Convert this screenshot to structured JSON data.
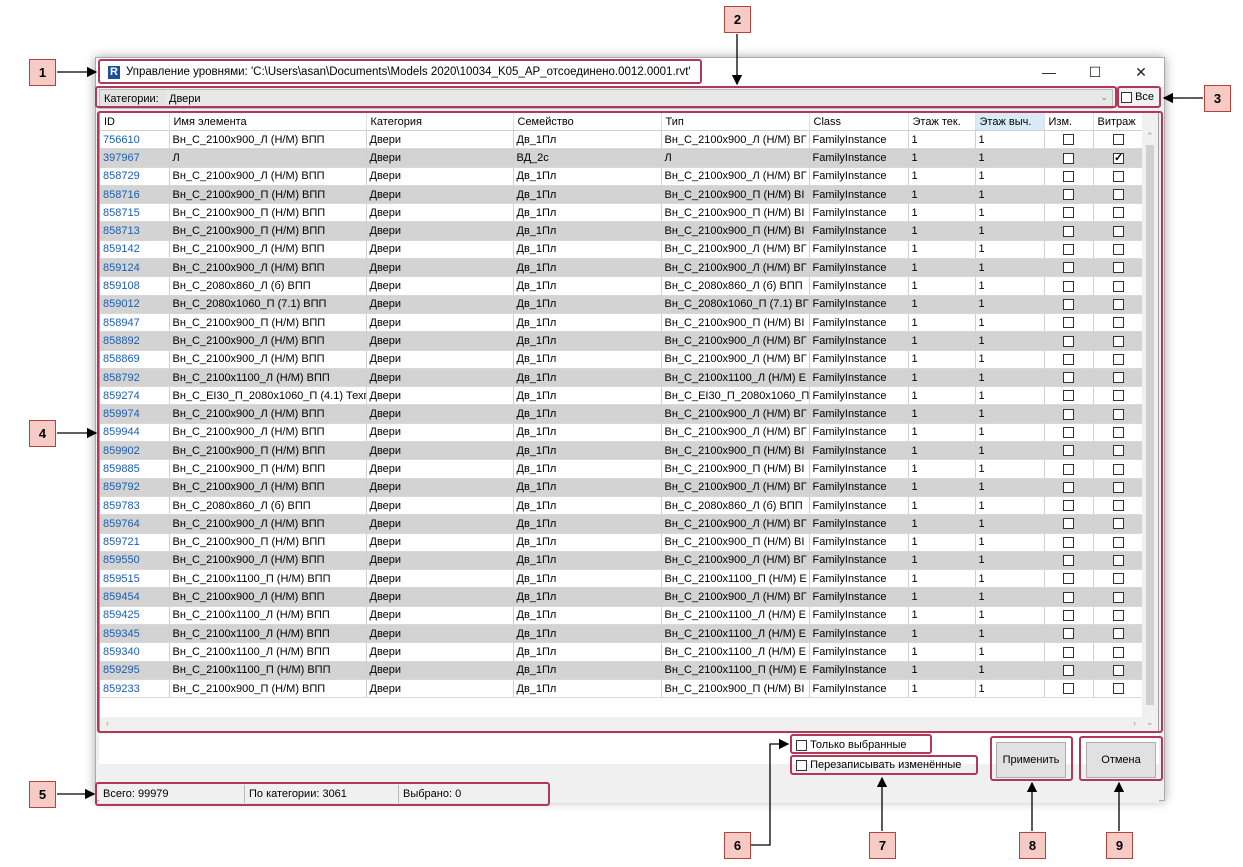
{
  "window": {
    "title": "Управление уровнями: 'C:\\Users\\asan\\Documents\\Models 2020\\10034_K05_AP_отсоединено.0012.0001.rvt'",
    "app_icon_letter": "R",
    "minimize": "—",
    "maximize": "☐",
    "close": "✕"
  },
  "category": {
    "label": "Категории:",
    "value": "Двери",
    "all_label": "Все"
  },
  "table": {
    "columns": [
      "ID",
      "Имя элемента",
      "Категория",
      "Семейство",
      "Тип",
      "Class",
      "Этаж тек.",
      "Этаж выч.",
      "Изм.",
      "Витраж"
    ],
    "rows": [
      {
        "id": "756610",
        "name": "Вн_С_2100х900_Л (Н/М) ВПП",
        "cat": "Двери",
        "family": "Дв_1Пл",
        "type": "Вн_С_2100х900_Л (Н/М) ВГ",
        "cls": "FamilyInstance",
        "cur": "1",
        "calc": "1",
        "mod": false,
        "wall": false
      },
      {
        "id": "397967",
        "name": "Л",
        "cat": "Двери",
        "family": "ВД_2с",
        "type": "Л",
        "cls": "FamilyInstance",
        "cur": "1",
        "calc": "1",
        "mod": false,
        "wall": true
      },
      {
        "id": "858729",
        "name": "Вн_С_2100х900_Л (Н/М) ВПП",
        "cat": "Двери",
        "family": "Дв_1Пл",
        "type": "Вн_С_2100х900_Л (Н/М) ВГ",
        "cls": "FamilyInstance",
        "cur": "1",
        "calc": "1",
        "mod": false,
        "wall": false
      },
      {
        "id": "858716",
        "name": "Вн_С_2100х900_П (Н/М) ВПП",
        "cat": "Двери",
        "family": "Дв_1Пл",
        "type": "Вн_С_2100х900_П (Н/М) ВІ",
        "cls": "FamilyInstance",
        "cur": "1",
        "calc": "1",
        "mod": false,
        "wall": false
      },
      {
        "id": "858715",
        "name": "Вн_С_2100х900_П (Н/М) ВПП",
        "cat": "Двери",
        "family": "Дв_1Пл",
        "type": "Вн_С_2100х900_П (Н/М) ВІ",
        "cls": "FamilyInstance",
        "cur": "1",
        "calc": "1",
        "mod": false,
        "wall": false
      },
      {
        "id": "858713",
        "name": "Вн_С_2100х900_П (Н/М) ВПП",
        "cat": "Двери",
        "family": "Дв_1Пл",
        "type": "Вн_С_2100х900_П (Н/М) ВІ",
        "cls": "FamilyInstance",
        "cur": "1",
        "calc": "1",
        "mod": false,
        "wall": false
      },
      {
        "id": "859142",
        "name": "Вн_С_2100х900_Л (Н/М) ВПП",
        "cat": "Двери",
        "family": "Дв_1Пл",
        "type": "Вн_С_2100х900_Л (Н/М) ВГ",
        "cls": "FamilyInstance",
        "cur": "1",
        "calc": "1",
        "mod": false,
        "wall": false
      },
      {
        "id": "859124",
        "name": "Вн_С_2100х900_Л (Н/М) ВПП",
        "cat": "Двери",
        "family": "Дв_1Пл",
        "type": "Вн_С_2100х900_Л (Н/М) ВГ",
        "cls": "FamilyInstance",
        "cur": "1",
        "calc": "1",
        "mod": false,
        "wall": false
      },
      {
        "id": "859108",
        "name": "Вн_С_2080х860_Л (б) ВПП",
        "cat": "Двери",
        "family": "Дв_1Пл",
        "type": "Вн_С_2080х860_Л (б) ВПП",
        "cls": "FamilyInstance",
        "cur": "1",
        "calc": "1",
        "mod": false,
        "wall": false
      },
      {
        "id": "859012",
        "name": "Вн_С_2080х1060_П (7.1) ВПП",
        "cat": "Двери",
        "family": "Дв_1Пл",
        "type": "Вн_С_2080х1060_П (7.1) ВГ",
        "cls": "FamilyInstance",
        "cur": "1",
        "calc": "1",
        "mod": false,
        "wall": false
      },
      {
        "id": "858947",
        "name": "Вн_С_2100х900_П (Н/М) ВПП",
        "cat": "Двери",
        "family": "Дв_1Пл",
        "type": "Вн_С_2100х900_П (Н/М) ВІ",
        "cls": "FamilyInstance",
        "cur": "1",
        "calc": "1",
        "mod": false,
        "wall": false
      },
      {
        "id": "858892",
        "name": "Вн_С_2100х900_Л (Н/М) ВПП",
        "cat": "Двери",
        "family": "Дв_1Пл",
        "type": "Вн_С_2100х900_Л (Н/М) ВГ",
        "cls": "FamilyInstance",
        "cur": "1",
        "calc": "1",
        "mod": false,
        "wall": false
      },
      {
        "id": "858869",
        "name": "Вн_С_2100х900_Л (Н/М) ВПП",
        "cat": "Двери",
        "family": "Дв_1Пл",
        "type": "Вн_С_2100х900_Л (Н/М) ВГ",
        "cls": "FamilyInstance",
        "cur": "1",
        "calc": "1",
        "mod": false,
        "wall": false
      },
      {
        "id": "858792",
        "name": "Вн_С_2100х1100_Л (Н/М) ВПП",
        "cat": "Двери",
        "family": "Дв_1Пл",
        "type": "Вн_С_2100х1100_Л (Н/М) Е",
        "cls": "FamilyInstance",
        "cur": "1",
        "calc": "1",
        "mod": false,
        "wall": false
      },
      {
        "id": "859274",
        "name": "Вн_С_EI30_П_2080х1060_П (4.1) Техп",
        "cat": "Двери",
        "family": "Дв_1Пл",
        "type": "Вн_С_EI30_П_2080х1060_П",
        "cls": "FamilyInstance",
        "cur": "1",
        "calc": "1",
        "mod": false,
        "wall": false
      },
      {
        "id": "859974",
        "name": "Вн_С_2100х900_Л (Н/М) ВПП",
        "cat": "Двери",
        "family": "Дв_1Пл",
        "type": "Вн_С_2100х900_Л (Н/М) ВГ",
        "cls": "FamilyInstance",
        "cur": "1",
        "calc": "1",
        "mod": false,
        "wall": false
      },
      {
        "id": "859944",
        "name": "Вн_С_2100х900_Л (Н/М) ВПП",
        "cat": "Двери",
        "family": "Дв_1Пл",
        "type": "Вн_С_2100х900_Л (Н/М) ВГ",
        "cls": "FamilyInstance",
        "cur": "1",
        "calc": "1",
        "mod": false,
        "wall": false
      },
      {
        "id": "859902",
        "name": "Вн_С_2100х900_П (Н/М) ВПП",
        "cat": "Двери",
        "family": "Дв_1Пл",
        "type": "Вн_С_2100х900_П (Н/М) ВІ",
        "cls": "FamilyInstance",
        "cur": "1",
        "calc": "1",
        "mod": false,
        "wall": false
      },
      {
        "id": "859885",
        "name": "Вн_С_2100х900_П (Н/М) ВПП",
        "cat": "Двери",
        "family": "Дв_1Пл",
        "type": "Вн_С_2100х900_П (Н/М) ВІ",
        "cls": "FamilyInstance",
        "cur": "1",
        "calc": "1",
        "mod": false,
        "wall": false
      },
      {
        "id": "859792",
        "name": "Вн_С_2100х900_Л (Н/М) ВПП",
        "cat": "Двери",
        "family": "Дв_1Пл",
        "type": "Вн_С_2100х900_Л (Н/М) ВГ",
        "cls": "FamilyInstance",
        "cur": "1",
        "calc": "1",
        "mod": false,
        "wall": false
      },
      {
        "id": "859783",
        "name": "Вн_С_2080х860_Л (б) ВПП",
        "cat": "Двери",
        "family": "Дв_1Пл",
        "type": "Вн_С_2080х860_Л (б) ВПП",
        "cls": "FamilyInstance",
        "cur": "1",
        "calc": "1",
        "mod": false,
        "wall": false
      },
      {
        "id": "859764",
        "name": "Вн_С_2100х900_Л (Н/М) ВПП",
        "cat": "Двери",
        "family": "Дв_1Пл",
        "type": "Вн_С_2100х900_Л (Н/М) ВГ",
        "cls": "FamilyInstance",
        "cur": "1",
        "calc": "1",
        "mod": false,
        "wall": false
      },
      {
        "id": "859721",
        "name": "Вн_С_2100х900_П (Н/М) ВПП",
        "cat": "Двери",
        "family": "Дв_1Пл",
        "type": "Вн_С_2100х900_П (Н/М) ВІ",
        "cls": "FamilyInstance",
        "cur": "1",
        "calc": "1",
        "mod": false,
        "wall": false
      },
      {
        "id": "859550",
        "name": "Вн_С_2100х900_Л (Н/М) ВПП",
        "cat": "Двери",
        "family": "Дв_1Пл",
        "type": "Вн_С_2100х900_Л (Н/М) ВГ",
        "cls": "FamilyInstance",
        "cur": "1",
        "calc": "1",
        "mod": false,
        "wall": false
      },
      {
        "id": "859515",
        "name": "Вн_С_2100х1100_П (Н/М) ВПП",
        "cat": "Двери",
        "family": "Дв_1Пл",
        "type": "Вн_С_2100х1100_П (Н/М) Е",
        "cls": "FamilyInstance",
        "cur": "1",
        "calc": "1",
        "mod": false,
        "wall": false
      },
      {
        "id": "859454",
        "name": "Вн_С_2100х900_Л (Н/М) ВПП",
        "cat": "Двери",
        "family": "Дв_1Пл",
        "type": "Вн_С_2100х900_Л (Н/М) ВГ",
        "cls": "FamilyInstance",
        "cur": "1",
        "calc": "1",
        "mod": false,
        "wall": false
      },
      {
        "id": "859425",
        "name": "Вн_С_2100х1100_Л (Н/М) ВПП",
        "cat": "Двери",
        "family": "Дв_1Пл",
        "type": "Вн_С_2100х1100_Л (Н/М) Е",
        "cls": "FamilyInstance",
        "cur": "1",
        "calc": "1",
        "mod": false,
        "wall": false
      },
      {
        "id": "859345",
        "name": "Вн_С_2100х1100_Л (Н/М) ВПП",
        "cat": "Двери",
        "family": "Дв_1Пл",
        "type": "Вн_С_2100х1100_Л (Н/М) Е",
        "cls": "FamilyInstance",
        "cur": "1",
        "calc": "1",
        "mod": false,
        "wall": false
      },
      {
        "id": "859340",
        "name": "Вн_С_2100х1100_Л (Н/М) ВПП",
        "cat": "Двери",
        "family": "Дв_1Пл",
        "type": "Вн_С_2100х1100_Л (Н/М) Е",
        "cls": "FamilyInstance",
        "cur": "1",
        "calc": "1",
        "mod": false,
        "wall": false
      },
      {
        "id": "859295",
        "name": "Вн_С_2100х1100_П (Н/М) ВПП",
        "cat": "Двери",
        "family": "Дв_1Пл",
        "type": "Вн_С_2100х1100_П (Н/М) Е",
        "cls": "FamilyInstance",
        "cur": "1",
        "calc": "1",
        "mod": false,
        "wall": false
      },
      {
        "id": "859233",
        "name": "Вн_С_2100х900_П (Н/М) ВПП",
        "cat": "Двери",
        "family": "Дв_1Пл",
        "type": "Вн_С_2100х900_П (Н/М) ВІ",
        "cls": "FamilyInstance",
        "cur": "1",
        "calc": "1",
        "mod": false,
        "wall": false
      }
    ]
  },
  "options": {
    "only_selected": "Только выбранные",
    "overwrite_changed": "Перезаписывать изменённые"
  },
  "buttons": {
    "apply": "Применить",
    "cancel": "Отмена"
  },
  "status": {
    "total": "Всего: 99979",
    "by_category": "По категории: 3061",
    "selected": "Выбрано: 0"
  },
  "callouts": [
    "1",
    "2",
    "3",
    "4",
    "5",
    "6",
    "7",
    "8",
    "9"
  ],
  "colors": {
    "frame": "#b2385a",
    "callout_fill": "#f6cbc5",
    "id_link": "#1a5fb4",
    "alt_row": "#d3d3d3"
  }
}
